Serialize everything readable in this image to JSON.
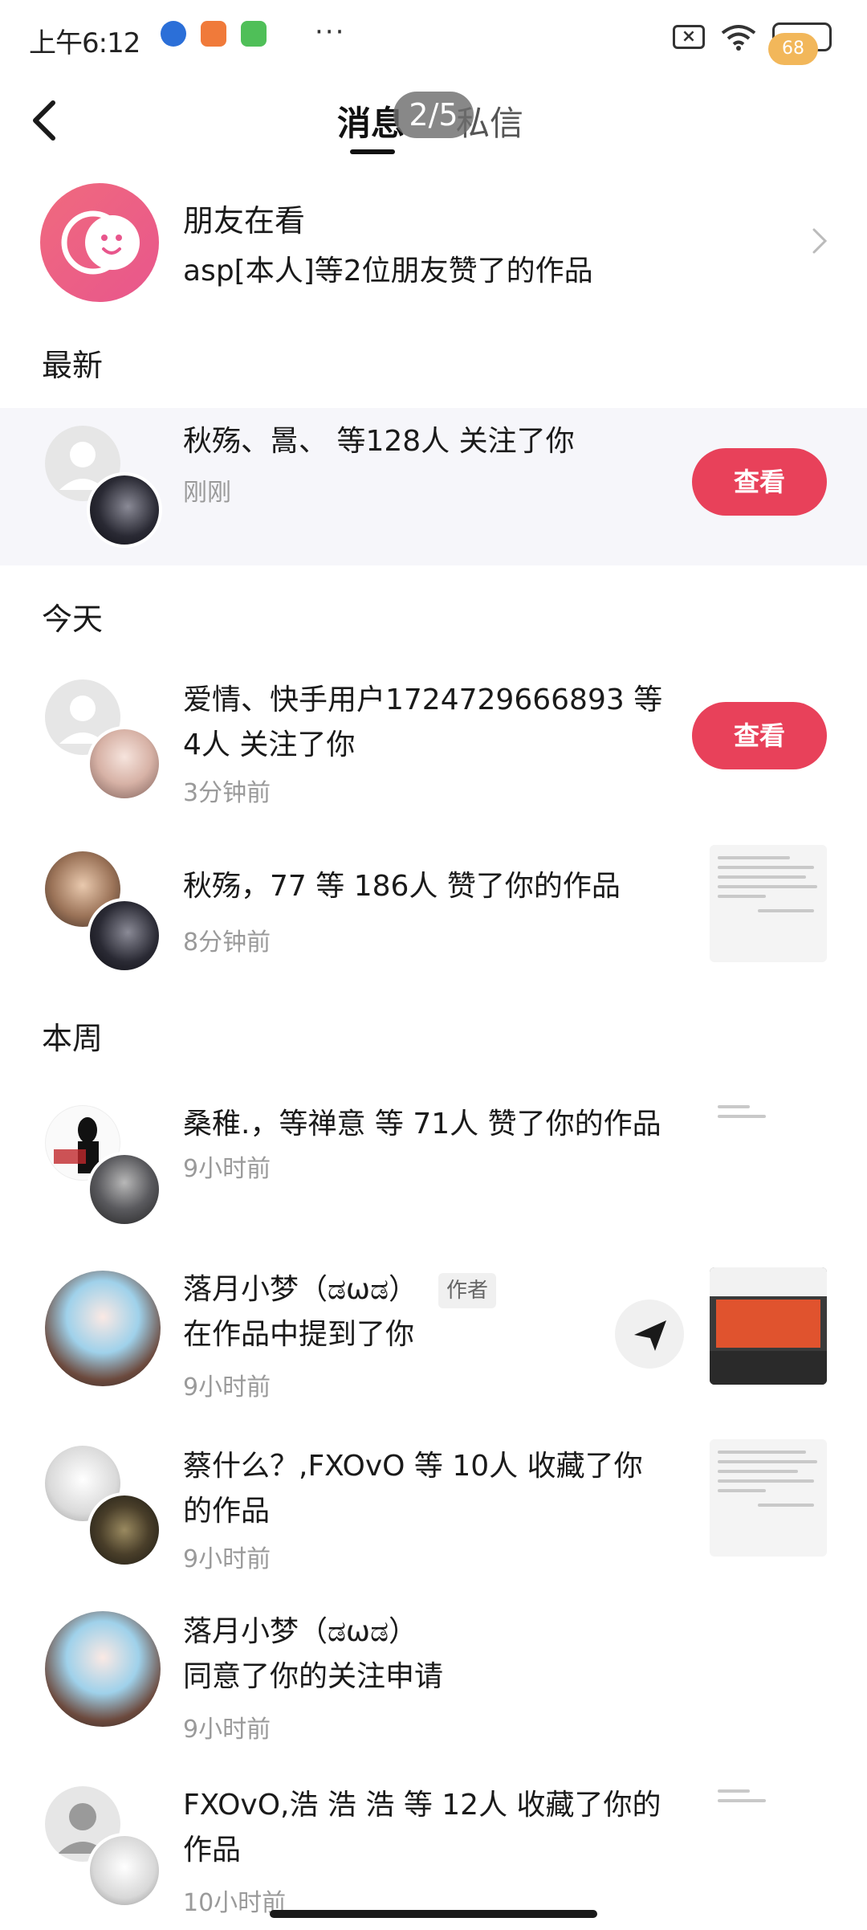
{
  "status_bar": {
    "time": "上午6:12",
    "more": "···",
    "battery": "68"
  },
  "header": {
    "tabs": [
      {
        "label": "消息"
      },
      {
        "label": "私信"
      }
    ],
    "page_indicator": "2/5"
  },
  "friends": {
    "title": "朋友在看",
    "subtitle": "asp[本人]等2位朋友赞了的作品"
  },
  "sections": {
    "latest": "最新",
    "today": "今天",
    "week": "本周"
  },
  "notifications": [
    {
      "text": "秋殇、暠、 等128人 关注了你",
      "time": "刚刚",
      "action": "查看"
    },
    {
      "text_line1": "爱情、快手用户1724729666893 等",
      "text_line2": "4人 关注了你",
      "time": "3分钟前",
      "action": "查看"
    },
    {
      "text": "秋殇，77 等 186人 赞了你的作品",
      "time": "8分钟前"
    },
    {
      "text": "桑稚.，等禅意 等 71人 赞了你的作品",
      "time": "9小时前"
    },
    {
      "name": "落月小梦（ಡωಡ）",
      "badge": "作者",
      "text": "在作品中提到了你",
      "time": "9小时前"
    },
    {
      "text_line1": "蔡什么？,FXOvO 等 10人 收藏了你",
      "text_line2": "的作品",
      "time": "9小时前"
    },
    {
      "name": "落月小梦（ಡωಡ）",
      "text": "同意了你的关注申请",
      "time": "9小时前"
    },
    {
      "text_line1": "FXOvO,浩 浩 浩 等 12人 收藏了你的",
      "text_line2": "作品",
      "time": "10小时前"
    }
  ],
  "colors": {
    "accent": "#e8415a",
    "highlight_bg": "#f6f6fa"
  }
}
